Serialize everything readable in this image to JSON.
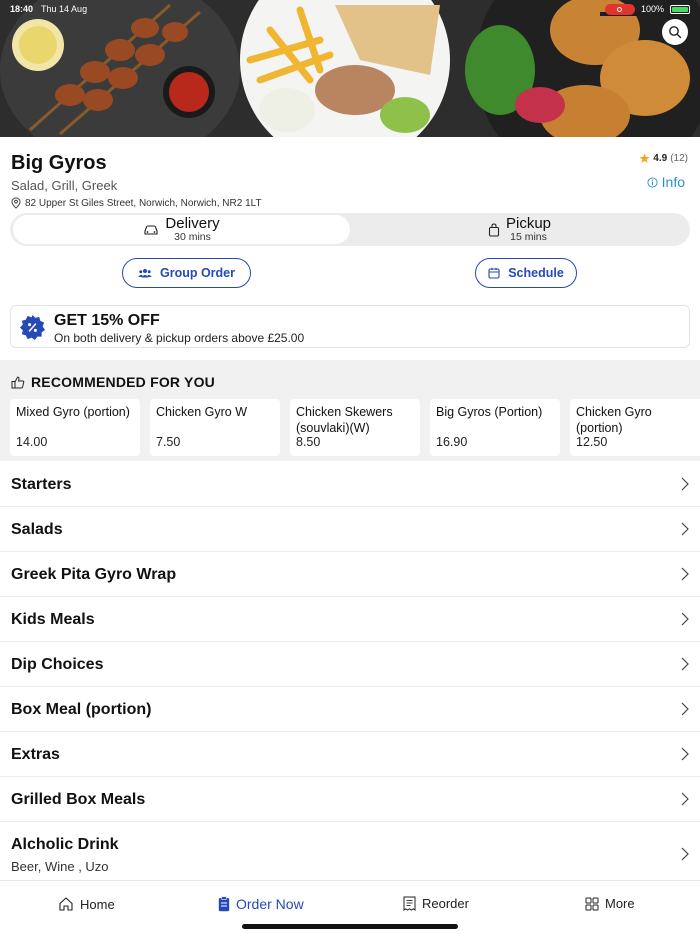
{
  "status_bar": {
    "time": "18:40",
    "date": "Thu 14 Aug",
    "battery": "100%"
  },
  "restaurant": {
    "name": "Big Gyros",
    "cuisine": "Salad, Grill, Greek",
    "address": "82 Upper St Giles Street, Norwich, Norwich, NR2 1LT",
    "rating": "4.9",
    "rating_count": "(12)",
    "info_label": "Info"
  },
  "mode": {
    "delivery": {
      "label": "Delivery",
      "time": "30 mins"
    },
    "pickup": {
      "label": "Pickup",
      "time": "15 mins"
    }
  },
  "actions": {
    "group_order": "Group Order",
    "schedule": "Schedule"
  },
  "promo": {
    "title": "GET 15% OFF",
    "subtitle": "On both delivery & pickup orders above £25.00"
  },
  "recommended": {
    "heading": "RECOMMENDED FOR YOU",
    "items": [
      {
        "name": "Mixed Gyro (portion)",
        "price": "14.00"
      },
      {
        "name": "Chicken Gyro W",
        "price": "7.50"
      },
      {
        "name": "Chicken Skewers (souvlaki)(W)",
        "price": "8.50"
      },
      {
        "name": "Big Gyros (Portion)",
        "price": "16.90"
      },
      {
        "name": "Chicken Gyro (portion)",
        "price": "12.50"
      }
    ]
  },
  "categories": [
    {
      "title": "Starters"
    },
    {
      "title": "Salads"
    },
    {
      "title": "Greek Pita Gyro Wrap"
    },
    {
      "title": "Kids Meals"
    },
    {
      "title": "Dip Choices"
    },
    {
      "title": "Box Meal (portion)"
    },
    {
      "title": "Extras"
    },
    {
      "title": "Grilled Box Meals"
    },
    {
      "title": "Alcholic Drink",
      "subtitle": "Beer, Wine , Uzo"
    }
  ],
  "bottom_nav": {
    "home": "Home",
    "order_now": "Order Now",
    "reorder": "Reorder",
    "more": "More"
  },
  "colors": {
    "accent": "#2649b8",
    "info": "#2b8fcf",
    "star": "#f5a623"
  }
}
